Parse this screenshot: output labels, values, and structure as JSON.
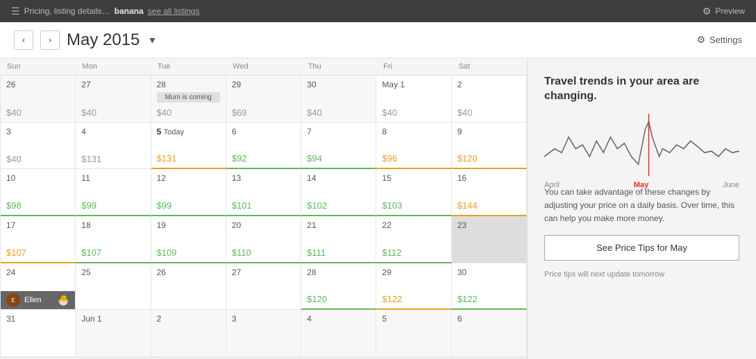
{
  "topNav": {
    "icon": "☰",
    "breadcrumb": "Pricing, listing details…",
    "listing": "banana",
    "seeAllLink": "see all listings",
    "previewLabel": "Preview"
  },
  "header": {
    "prevLabel": "‹",
    "nextLabel": "›",
    "monthTitle": "May 2015",
    "dropdownArrow": "▾",
    "settingsLabel": "Settings"
  },
  "dayHeaders": [
    "Sun",
    "Mon",
    "Tue",
    "Wed",
    "Thu",
    "Fri",
    "Sat"
  ],
  "chartLabels": [
    "April",
    "May",
    "June"
  ],
  "panel": {
    "title": "Travel trends in your area are changing.",
    "description": "You can take advantage of these changes by adjusting your price on a daily basis. Over time, this can help you make more money.",
    "buttonLabel": "See Price Tips for May",
    "updateNote": "Price tips will next update tomorrow"
  },
  "weeks": [
    {
      "days": [
        {
          "num": "26",
          "faded": true,
          "price": "$40",
          "priceClass": "price-gray",
          "border": ""
        },
        {
          "num": "27",
          "faded": true,
          "price": "$40",
          "priceClass": "price-gray",
          "border": ""
        },
        {
          "num": "28",
          "faded": true,
          "price": "$40",
          "priceClass": "price-gray",
          "border": "",
          "event": "Mum is coming"
        },
        {
          "num": "29",
          "faded": true,
          "price": "$69",
          "priceClass": "price-gray",
          "border": ""
        },
        {
          "num": "30",
          "faded": true,
          "price": "$40",
          "priceClass": "price-gray",
          "border": ""
        },
        {
          "num": "May 1",
          "faded": false,
          "price": "$40",
          "priceClass": "price-gray",
          "border": ""
        },
        {
          "num": "2",
          "faded": false,
          "price": "$40",
          "priceClass": "price-gray",
          "border": ""
        }
      ]
    },
    {
      "days": [
        {
          "num": "3",
          "faded": false,
          "price": "$40",
          "priceClass": "price-gray",
          "border": ""
        },
        {
          "num": "4",
          "faded": false,
          "price": "$131",
          "priceClass": "price-gray",
          "border": ""
        },
        {
          "num": "5 Today",
          "isToday": true,
          "price": "$131",
          "priceClass": "price-orange",
          "border": "border-orange"
        },
        {
          "num": "6",
          "faded": false,
          "price": "$92",
          "priceClass": "price-green",
          "border": "border-green"
        },
        {
          "num": "7",
          "faded": false,
          "price": "$94",
          "priceClass": "price-green",
          "border": "border-green"
        },
        {
          "num": "8",
          "faded": false,
          "price": "$96",
          "priceClass": "price-orange",
          "border": "border-orange"
        },
        {
          "num": "9",
          "faded": false,
          "price": "$120",
          "priceClass": "price-orange",
          "border": "border-orange"
        }
      ]
    },
    {
      "days": [
        {
          "num": "10",
          "faded": false,
          "price": "$98",
          "priceClass": "price-green",
          "border": "border-green"
        },
        {
          "num": "11",
          "faded": false,
          "price": "$99",
          "priceClass": "price-green",
          "border": "border-green"
        },
        {
          "num": "12",
          "faded": false,
          "price": "$99",
          "priceClass": "price-green",
          "border": "border-green"
        },
        {
          "num": "13",
          "faded": false,
          "price": "$101",
          "priceClass": "price-green",
          "border": "border-green"
        },
        {
          "num": "14",
          "faded": false,
          "price": "$102",
          "priceClass": "price-green",
          "border": "border-green"
        },
        {
          "num": "15",
          "faded": false,
          "price": "$103",
          "priceClass": "price-green",
          "border": "border-green"
        },
        {
          "num": "16",
          "faded": false,
          "price": "$144",
          "priceClass": "price-orange",
          "border": "border-orange"
        }
      ]
    },
    {
      "days": [
        {
          "num": "17",
          "faded": false,
          "price": "$107",
          "priceClass": "price-orange",
          "border": "border-orange"
        },
        {
          "num": "18",
          "faded": false,
          "price": "$107",
          "priceClass": "price-green",
          "border": "border-green"
        },
        {
          "num": "19",
          "faded": false,
          "price": "$109",
          "priceClass": "price-green",
          "border": "border-green"
        },
        {
          "num": "20",
          "faded": false,
          "price": "$110",
          "priceClass": "price-green",
          "border": "border-green"
        },
        {
          "num": "21",
          "faded": false,
          "price": "$111",
          "priceClass": "price-green",
          "border": "border-green"
        },
        {
          "num": "22",
          "faded": false,
          "price": "$112",
          "priceClass": "price-green",
          "border": "border-green"
        },
        {
          "num": "23",
          "faded": false,
          "blocked": true,
          "price": "",
          "priceClass": "",
          "border": ""
        }
      ]
    },
    {
      "days": [
        {
          "num": "24",
          "faded": false,
          "hasGuest": true,
          "guestName": "Ellen",
          "price": "",
          "priceClass": "",
          "border": ""
        },
        {
          "num": "25",
          "faded": false,
          "price": "",
          "priceClass": "",
          "border": ""
        },
        {
          "num": "26",
          "faded": false,
          "price": "",
          "priceClass": "",
          "border": ""
        },
        {
          "num": "27",
          "faded": false,
          "price": "",
          "priceClass": "",
          "border": ""
        },
        {
          "num": "28",
          "faded": false,
          "price": "$120",
          "priceClass": "price-green",
          "border": "border-green"
        },
        {
          "num": "29",
          "faded": false,
          "price": "$122",
          "priceClass": "price-orange",
          "border": "border-orange"
        },
        {
          "num": "30",
          "faded": false,
          "price": "$122",
          "priceClass": "price-green",
          "border": "border-green"
        }
      ]
    },
    {
      "days": [
        {
          "num": "31",
          "faded": false,
          "price": "",
          "priceClass": "",
          "border": ""
        },
        {
          "num": "Jun 1",
          "faded": true,
          "price": "",
          "priceClass": "",
          "border": ""
        },
        {
          "num": "2",
          "faded": true,
          "price": "",
          "priceClass": "",
          "border": ""
        },
        {
          "num": "3",
          "faded": true,
          "price": "",
          "priceClass": "",
          "border": ""
        },
        {
          "num": "4",
          "faded": true,
          "price": "",
          "priceClass": "",
          "border": ""
        },
        {
          "num": "5",
          "faded": true,
          "price": "",
          "priceClass": "",
          "border": ""
        },
        {
          "num": "6",
          "faded": true,
          "price": "",
          "priceClass": "",
          "border": ""
        }
      ]
    }
  ]
}
